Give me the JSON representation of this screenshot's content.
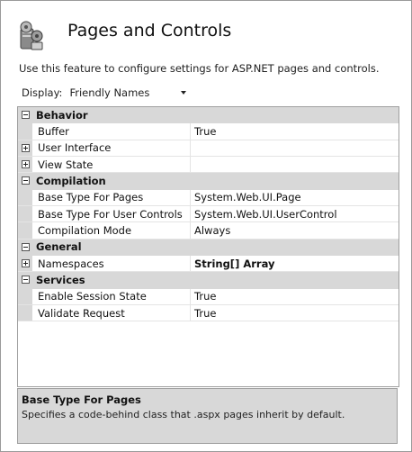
{
  "header": {
    "title": "Pages and Controls",
    "description": "Use this feature to configure settings for ASP.NET pages and controls.",
    "icon": "settings-gears-icon"
  },
  "display": {
    "label": "Display:",
    "value": "Friendly Names"
  },
  "grid": {
    "categories": [
      {
        "label": "Behavior",
        "properties": [
          {
            "name": "Buffer",
            "value": "True",
            "expandable": false
          },
          {
            "name": "User Interface",
            "value": "",
            "expandable": true
          },
          {
            "name": "View State",
            "value": "",
            "expandable": true
          }
        ]
      },
      {
        "label": "Compilation",
        "properties": [
          {
            "name": "Base Type For Pages",
            "value": "System.Web.UI.Page",
            "expandable": false
          },
          {
            "name": "Base Type For User Controls",
            "value": "System.Web.UI.UserControl",
            "expandable": false
          },
          {
            "name": "Compilation Mode",
            "value": "Always",
            "expandable": false
          }
        ]
      },
      {
        "label": "General",
        "properties": [
          {
            "name": "Namespaces",
            "value": "String[] Array",
            "expandable": true
          }
        ]
      },
      {
        "label": "Services",
        "properties": [
          {
            "name": "Enable Session State",
            "value": "True",
            "expandable": false
          },
          {
            "name": "Validate Request",
            "value": "True",
            "expandable": false
          }
        ]
      }
    ]
  },
  "description_panel": {
    "title": "Base Type For Pages",
    "text": "Specifies a code-behind class that .aspx pages inherit by default."
  },
  "colors": {
    "category_background": "#d8d8d8",
    "border": "#a0a0a0"
  }
}
